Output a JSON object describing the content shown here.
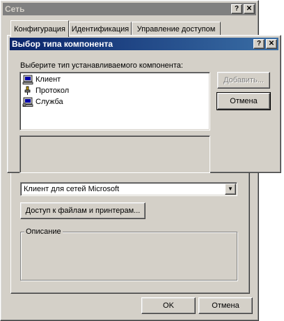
{
  "network_dialog": {
    "title": "Сеть",
    "title_buttons": {
      "help": "?",
      "close": "✕"
    },
    "tabs": [
      {
        "label": "Конфигурация"
      },
      {
        "label": "Идентификация"
      },
      {
        "label": "Управление доступом"
      }
    ],
    "logon_select": {
      "value": "Клиент для сетей Microsoft"
    },
    "file_sharing_button": "Доступ к файлам и принтерам...",
    "description_group": "Описание",
    "ok_button": "OK",
    "cancel_button": "Отмена"
  },
  "component_dialog": {
    "title": "Выбор типа компонента",
    "title_buttons": {
      "help": "?",
      "close": "✕"
    },
    "prompt": "Выберите тип устанавливаемого компонента:",
    "items": [
      {
        "label": "Клиент",
        "icon": "client-computer-icon"
      },
      {
        "label": "Протокол",
        "icon": "protocol-plug-icon"
      },
      {
        "label": "Служба",
        "icon": "service-computer-icon"
      }
    ],
    "add_button": "Добавить...",
    "cancel_button": "Отмена"
  },
  "colors": {
    "active_title": "#0a246a",
    "inactive_title": "#808080",
    "face": "#d4d0c8"
  }
}
